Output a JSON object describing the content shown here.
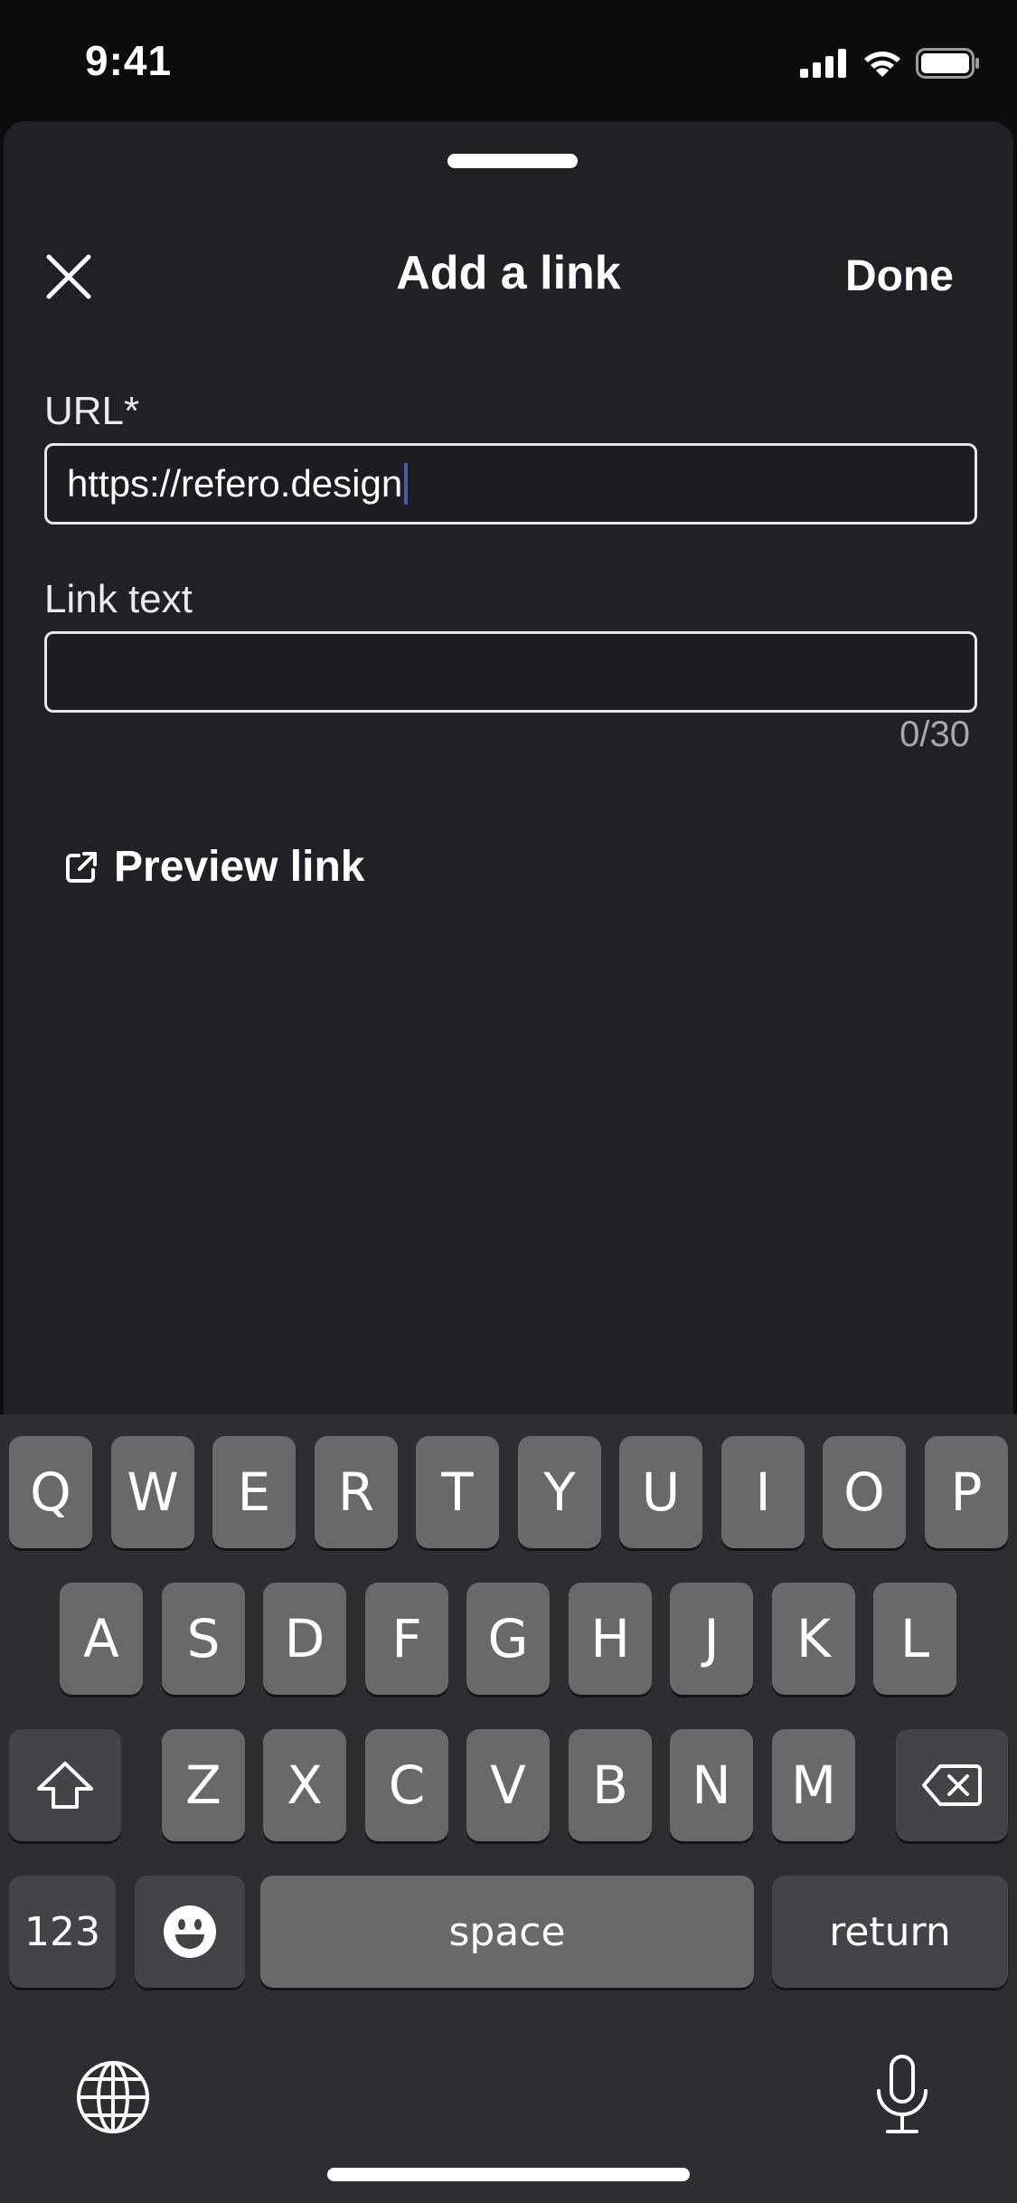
{
  "status_bar": {
    "time": "9:41",
    "icons": [
      "cellular-signal-icon",
      "wifi-icon",
      "battery-icon"
    ]
  },
  "sheet": {
    "title": "Add a link",
    "close_icon": "close-icon",
    "done_label": "Done"
  },
  "form": {
    "url_label": "URL*",
    "url_value": "https://refero.design",
    "link_text_label": "Link text",
    "link_text_value": "",
    "counter": "0/30"
  },
  "preview": {
    "icon": "external-link-icon",
    "label": "Preview link"
  },
  "keyboard": {
    "row1": [
      "Q",
      "W",
      "E",
      "R",
      "T",
      "Y",
      "U",
      "I",
      "O",
      "P"
    ],
    "row2": [
      "A",
      "S",
      "D",
      "F",
      "G",
      "H",
      "J",
      "K",
      "L"
    ],
    "row3": [
      "Z",
      "X",
      "C",
      "V",
      "B",
      "N",
      "M"
    ],
    "shift_icon": "shift-icon",
    "backspace_icon": "backspace-icon",
    "numbers_label": "123",
    "emoji_icon": "emoji-icon",
    "space_label": "space",
    "return_label": "return",
    "globe_icon": "globe-icon",
    "mic_icon": "microphone-icon"
  },
  "colors": {
    "sheet_bg": "#1f2125",
    "keyboard_bg": "#2d2e31",
    "key_bg": "#69696b",
    "key_dark_bg": "#434447",
    "caret": "#4b5aa6"
  }
}
